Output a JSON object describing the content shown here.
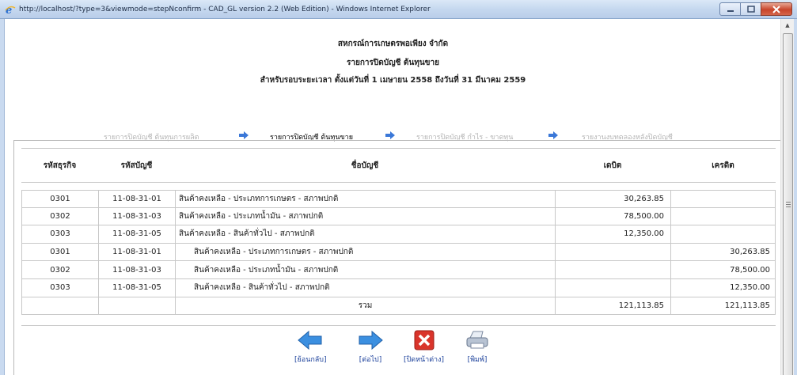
{
  "window": {
    "title": "http://localhost/?type=3&viewmode=stepNconfirm - CAD_GL version 2.2 (Web Edition) - Windows Internet Explorer"
  },
  "report": {
    "org_name": "สหกรณ์การเกษตรพอเพียง จำกัด",
    "report_title": "รายการปิดบัญชี ต้นทุนขาย",
    "period": "สำหรับรอบระยะเวลา ตั้งแต่วันที่ 1 เมษายน 2558 ถึงวันที่ 31 มีนาคม 2559"
  },
  "steps": [
    {
      "label": "รายการปิดบัญชี ต้นทุนการผลิต",
      "active": false
    },
    {
      "label": "รายการปิดบัญชี ต้นทุนขาย",
      "active": true
    },
    {
      "label": "รายการปิดบัญชี กำไร - ขาดทุน",
      "active": false
    },
    {
      "label": "รายงานงบทดลองหลังปิดบัญชี",
      "active": false
    }
  ],
  "table": {
    "headers": [
      "รหัสธุรกิจ",
      "รหัสบัญชี",
      "ชื่อบัญชี",
      "เดบิต",
      "เครดิต"
    ],
    "rows": [
      {
        "business": "0301",
        "account": "11-08-31-01",
        "name": "สินค้าคงเหลือ - ประเภทการเกษตร - สภาพปกติ",
        "debit": "30,263.85",
        "credit": ""
      },
      {
        "business": "0302",
        "account": "11-08-31-03",
        "name": "สินค้าคงเหลือ - ประเภทน้ำมัน - สภาพปกติ",
        "debit": "78,500.00",
        "credit": ""
      },
      {
        "business": "0303",
        "account": "11-08-31-05",
        "name": "สินค้าคงเหลือ - สินค้าทั่วไป - สภาพปกติ",
        "debit": "12,350.00",
        "credit": ""
      },
      {
        "business": "0301",
        "account": "11-08-31-01",
        "name": "สินค้าคงเหลือ - ประเภทการเกษตร - สภาพปกติ",
        "debit": "",
        "credit": "30,263.85"
      },
      {
        "business": "0302",
        "account": "11-08-31-03",
        "name": "สินค้าคงเหลือ - ประเภทน้ำมัน - สภาพปกติ",
        "debit": "",
        "credit": "78,500.00"
      },
      {
        "business": "0303",
        "account": "11-08-31-05",
        "name": "สินค้าคงเหลือ - สินค้าทั่วไป - สภาพปกติ",
        "debit": "",
        "credit": "12,350.00"
      }
    ],
    "total": {
      "label": "รวม",
      "debit": "121,113.85",
      "credit": "121,113.85"
    }
  },
  "actions": {
    "back": "[ย้อนกลับ]",
    "next": "[ต่อไป]",
    "close": "[ปิดหน้าต่าง]",
    "print": "[พิมพ์]"
  },
  "colors": {
    "inactive_step": "#b4b4b4",
    "link": "#1a3f9a",
    "arrow": "#3b78d8",
    "close_red": "#d9342b"
  },
  "icons": [
    "ie-icon",
    "minimize-icon",
    "maximize-icon",
    "close-window-icon",
    "arrow-right-icon",
    "arrow-left-icon",
    "close-x-icon",
    "printer-icon"
  ]
}
